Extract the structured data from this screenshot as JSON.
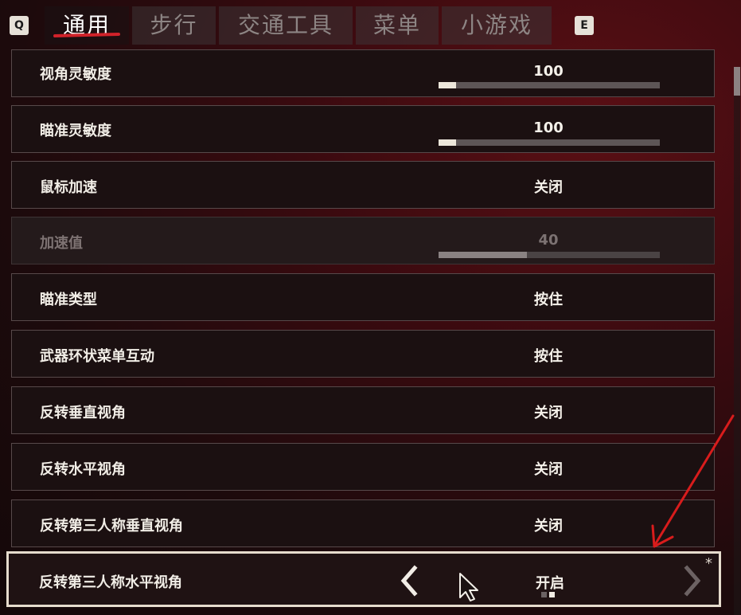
{
  "key_hints": {
    "prev": "Q",
    "next": "E"
  },
  "tabs": [
    {
      "label": "通用",
      "active": true
    },
    {
      "label": "步行",
      "active": false
    },
    {
      "label": "交通工具",
      "active": false
    },
    {
      "label": "菜单",
      "active": false
    },
    {
      "label": "小游戏",
      "active": false
    }
  ],
  "settings": [
    {
      "label": "视角灵敏度",
      "value": "100",
      "type": "slider",
      "fill_fraction": 0.08
    },
    {
      "label": "瞄准灵敏度",
      "value": "100",
      "type": "slider",
      "fill_fraction": 0.08
    },
    {
      "label": "鼠标加速",
      "value": "关闭",
      "type": "option"
    },
    {
      "label": "加速值",
      "value": "40",
      "type": "slider",
      "fill_fraction": 0.4,
      "disabled": true
    },
    {
      "label": "瞄准类型",
      "value": "按住",
      "type": "option"
    },
    {
      "label": "武器环状菜单互动",
      "value": "按住",
      "type": "option"
    },
    {
      "label": "反转垂直视角",
      "value": "关闭",
      "type": "option"
    },
    {
      "label": "反转水平视角",
      "value": "关闭",
      "type": "option"
    },
    {
      "label": "反转第三人称垂直视角",
      "value": "关闭",
      "type": "option"
    },
    {
      "label": "反转第三人称水平视角",
      "value": "开启",
      "type": "selector",
      "selected": true,
      "option_count": 2,
      "option_index": 1,
      "modified_marker": "*"
    }
  ],
  "colors": {
    "accent_red": "#d1222a",
    "selected_border": "#e6dccd",
    "annotation_arrow": "#d81c1c"
  },
  "icons": {
    "left_arrow": "chevron-left-icon",
    "right_arrow": "chevron-right-icon",
    "cursor": "mouse-cursor-icon",
    "annotation": "red-arrow-icon"
  }
}
